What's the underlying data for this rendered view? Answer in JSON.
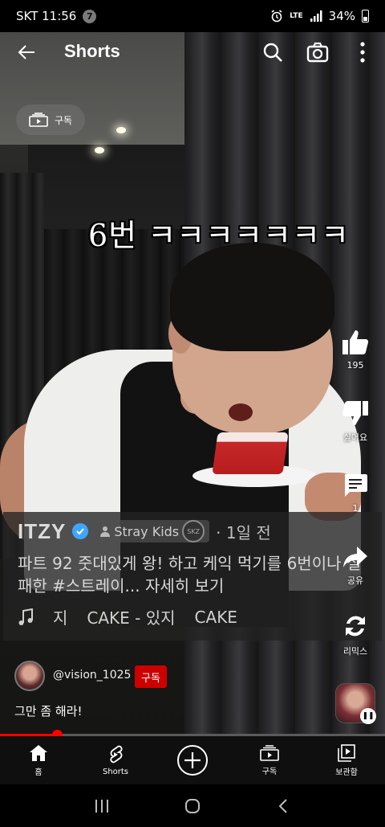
{
  "status_bar": {
    "carrier_time": "SKT 11:56",
    "notification_count": "7",
    "network": "LTE",
    "battery": "34%"
  },
  "topbar": {
    "title": "Shorts"
  },
  "subscriptions_chip": {
    "label": "구독"
  },
  "video": {
    "caption_overlay": "6번 ㅋㅋㅋㅋㅋㅋㅋ"
  },
  "info": {
    "channel_name": "ITZY",
    "collab_channel": "Stray Kids",
    "time_ago": "· 1일 전",
    "description": "파트 92   줏대있게 왕! 하고 케익 먹기를 6번이나 실패한 #스트레이...",
    "more_label": "자세히 보기",
    "music_items": [
      "지",
      "CAKE - 있지",
      "CAKE"
    ]
  },
  "rail": {
    "like_count": "195",
    "dislike_label": "싫어요",
    "comment_count": "1",
    "share_label": "공유",
    "remix_label": "리믹스"
  },
  "comment": {
    "handle": "@vision_1025",
    "subscribe_label": "구독",
    "text": "그만 좀 해라!"
  },
  "progress": {
    "fraction": 0.148
  },
  "bottom_nav": {
    "home": "홈",
    "shorts": "Shorts",
    "subscriptions": "구독",
    "library": "보관함"
  },
  "colors": {
    "accent_red": "#ff0000",
    "subscribe_red": "#cc0000",
    "verified_blue": "#3ea6ff"
  }
}
